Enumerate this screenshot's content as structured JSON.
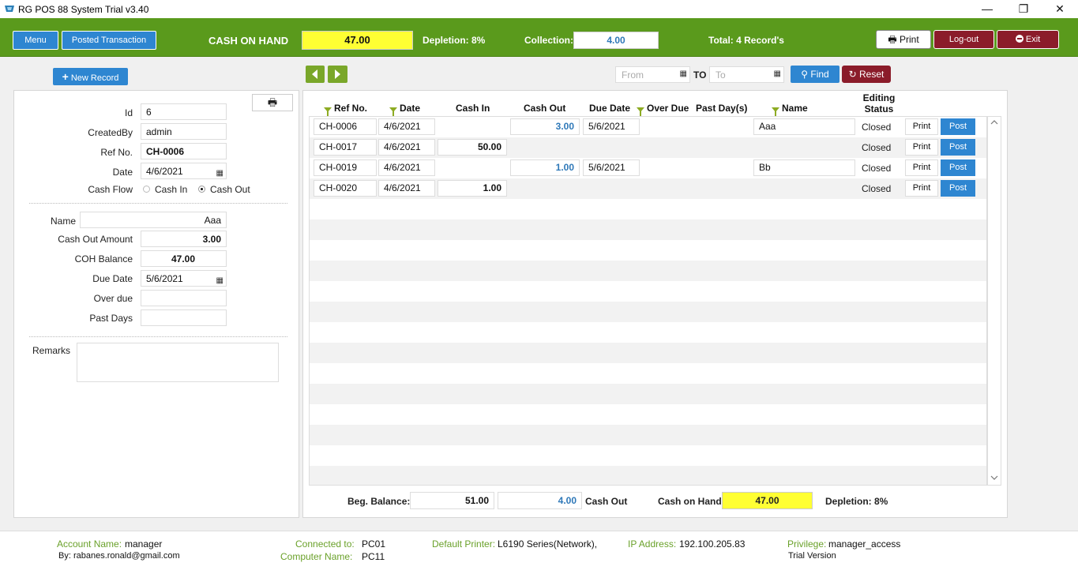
{
  "window": {
    "title": "RG POS 88 System Trial v3.40",
    "minimize": "—",
    "restore": "❐",
    "close": "✕"
  },
  "topbar": {
    "menu_label": "Menu",
    "posted_label": "Posted Transaction",
    "cash_on_hand_label": "CASH ON HAND",
    "cash_on_hand_value": "47.00",
    "depletion_label": "Depletion: 8%",
    "collection_label": "Collection:",
    "collection_value": "4.00",
    "total_label": "Total: 4 Record's",
    "print_label": "Print",
    "logout_label": "Log-out",
    "exit_label": "Exit"
  },
  "toolbar": {
    "new_record_label": "New Record",
    "from_placeholder": "From",
    "to_label": "TO",
    "to_placeholder": "To",
    "find_label": "Find",
    "reset_label": "Reset"
  },
  "form": {
    "id_label": "Id",
    "id_value": "6",
    "created_by_label": "CreatedBy",
    "created_by_value": "admin",
    "ref_no_label": "Ref No.",
    "ref_no_value": "CH-0006",
    "date_label": "Date",
    "date_value": "4/6/2021",
    "cash_flow_label": "Cash Flow",
    "cash_in_option": "Cash In",
    "cash_out_option": "Cash Out",
    "cash_flow_selected": "Cash Out",
    "name_label": "Name",
    "name_value": "Aaa",
    "cash_out_amount_label": "Cash Out Amount",
    "cash_out_amount_value": "3.00",
    "coh_balance_label": "COH Balance",
    "coh_balance_value": "47.00",
    "due_date_label": "Due Date",
    "due_date_value": "5/6/2021",
    "over_due_label": "Over due",
    "over_due_value": "",
    "past_days_label": "Past Days",
    "past_days_value": "",
    "remarks_label": "Remarks",
    "remarks_value": ""
  },
  "table": {
    "headers": {
      "ref_no": "Ref No.",
      "date": "Date",
      "cash_in": "Cash In",
      "cash_out": "Cash Out",
      "due_date": "Due Date",
      "over_due": "Over Due",
      "past_days": "Past Day(s)",
      "name": "Name",
      "editing_status_1": "Editing",
      "editing_status_2": "Status"
    },
    "print_label": "Print",
    "post_label": "Post",
    "rows": [
      {
        "ref_no": "CH-0006",
        "date": "4/6/2021",
        "cash_in": "",
        "cash_out": "3.00",
        "due_date": "5/6/2021",
        "name": "Aaa",
        "status": "Closed"
      },
      {
        "ref_no": "CH-0017",
        "date": "4/6/2021",
        "cash_in": "50.00",
        "cash_out": "",
        "due_date": "",
        "name": "",
        "status": "Closed"
      },
      {
        "ref_no": "CH-0019",
        "date": "4/6/2021",
        "cash_in": "",
        "cash_out": "1.00",
        "due_date": "5/6/2021",
        "name": "Bb",
        "status": "Closed"
      },
      {
        "ref_no": "CH-0020",
        "date": "4/6/2021",
        "cash_in": "1.00",
        "cash_out": "",
        "due_date": "",
        "name": "",
        "status": "Closed"
      }
    ]
  },
  "summary": {
    "beg_balance_label": "Beg. Balance:",
    "beg_balance_value": "51.00",
    "cash_out_value": "4.00",
    "cash_out_label": "Cash Out",
    "cash_on_hand_label": "Cash on Hand",
    "cash_on_hand_value": "47.00",
    "depletion_label": "Depletion: 8%"
  },
  "footer": {
    "account_name_label": "Account Name:",
    "account_name_value": "manager",
    "by_text": "By: rabanes.ronald@gmail.com",
    "connected_label": "Connected to:",
    "connected_value": "PC01",
    "computer_label": "Computer Name:",
    "computer_value": "PC11",
    "printer_label": "Default Printer:",
    "printer_value": "L6190 Series(Network),",
    "ip_label": "IP Address:",
    "ip_value": "192.100.205.83",
    "privilege_label": "Privilege:",
    "privilege_value": "manager_access",
    "trial_text": "Trial Version"
  },
  "colors": {
    "green_bar": "#5a9a1c",
    "accent_blue": "#2e86d1",
    "maroon": "#8b1c2a",
    "highlight_yellow": "#ffff33"
  }
}
